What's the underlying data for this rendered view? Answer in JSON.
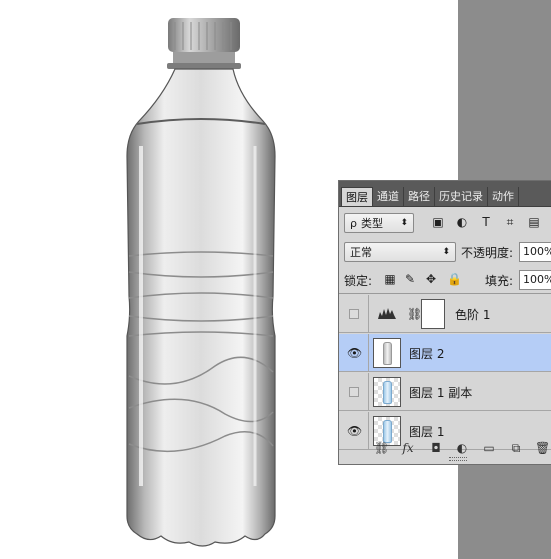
{
  "panel": {
    "tabs": [
      "图层",
      "通道",
      "路径",
      "历史记录",
      "动作"
    ],
    "filter": {
      "label": "类型",
      "search_glyph": "ρ"
    },
    "blend_mode": "正常",
    "opacity_label": "不透明度:",
    "opacity_value": "100%",
    "lock_label": "锁定:",
    "fill_label": "填充:",
    "fill_value": "100%",
    "layers": [
      {
        "name": "色阶 1",
        "visible": false,
        "selected": false
      },
      {
        "name": "图层 2",
        "visible": true,
        "selected": true
      },
      {
        "name": "图层 1 副本",
        "visible": false,
        "selected": false
      },
      {
        "name": "图层 1",
        "visible": true,
        "selected": false
      }
    ],
    "footer_icons": [
      "link-layers-icon",
      "fx-icon",
      "add-mask-icon",
      "adjustment-icon",
      "group-folder-icon",
      "new-layer-icon",
      "trash-icon"
    ]
  },
  "colors": {
    "selection": "#b5cdf6",
    "panel": "#d6d6d6",
    "tab_bar": "#5a5a5a",
    "canvas_bg": "#8c8c8c"
  }
}
